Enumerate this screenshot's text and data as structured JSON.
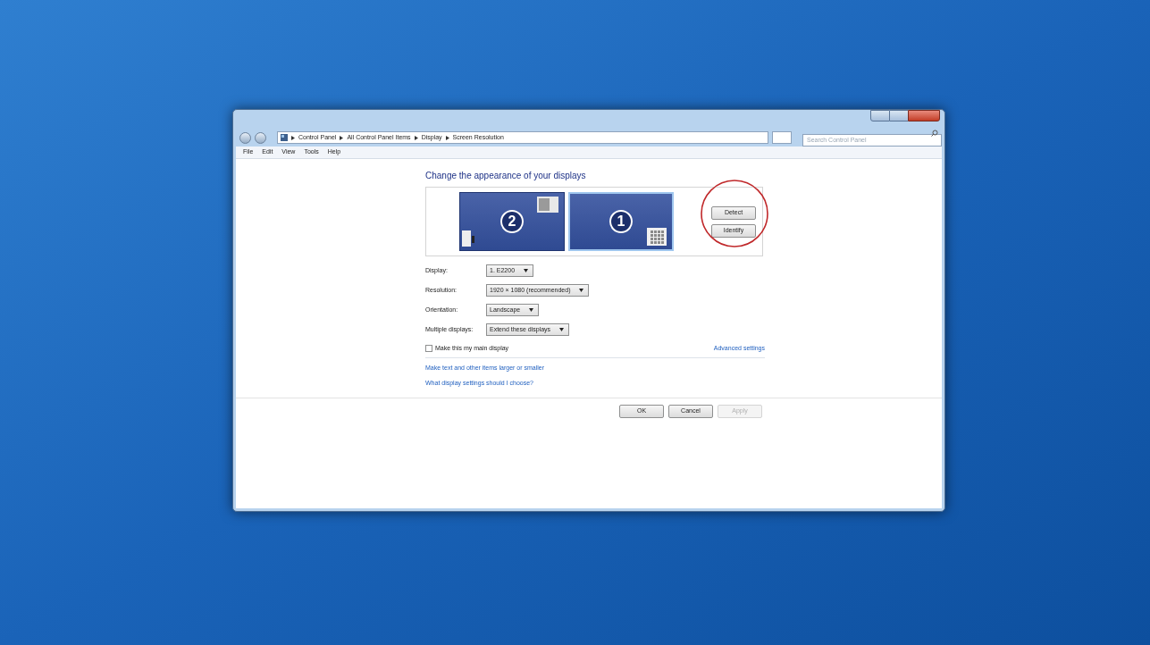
{
  "address_bar": {
    "breadcrumbs": [
      "Control Panel",
      "All Control Panel Items",
      "Display",
      "Screen Resolution"
    ]
  },
  "search": {
    "placeholder": "Search Control Panel"
  },
  "menu": [
    "File",
    "Edit",
    "View",
    "Tools",
    "Help"
  ],
  "heading": "Change the appearance of your displays",
  "monitors": [
    {
      "label": "2",
      "selected": false
    },
    {
      "label": "1",
      "selected": true
    }
  ],
  "side_buttons": [
    "Detect",
    "Identify"
  ],
  "fields": [
    {
      "label": "Display:",
      "value": "1. E2200"
    },
    {
      "label": "Resolution:",
      "value": "1920 × 1080 (recommended)"
    },
    {
      "label": "Orientation:",
      "value": "Landscape"
    },
    {
      "label": "Multiple displays:",
      "value": "Extend these displays"
    }
  ],
  "main_display": {
    "label": "Make this my main display",
    "checked": false
  },
  "advanced_link": "Advanced settings",
  "links": [
    "Make text and other items larger or smaller",
    "What display settings should I choose?"
  ],
  "buttons": [
    {
      "label": "OK",
      "disabled": false
    },
    {
      "label": "Cancel",
      "disabled": false
    },
    {
      "label": "Apply",
      "disabled": true
    }
  ]
}
